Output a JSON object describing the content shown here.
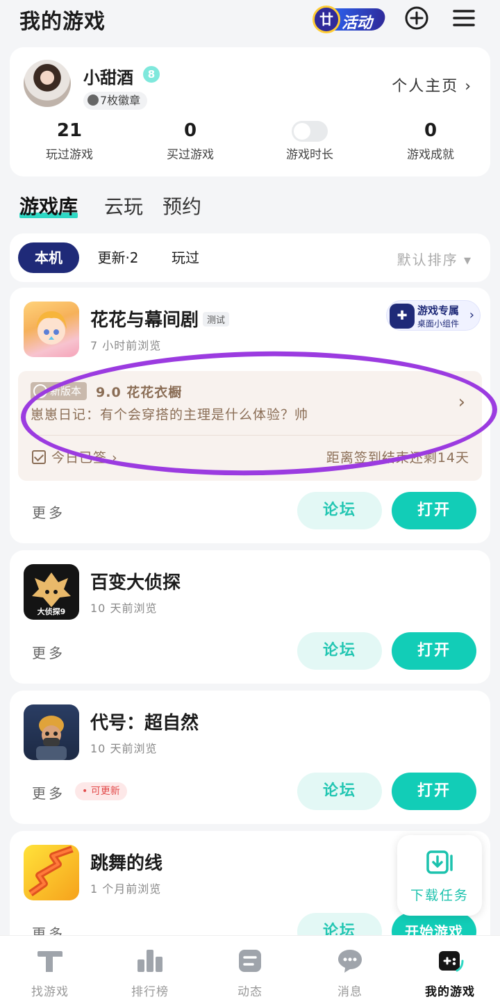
{
  "header": {
    "title": "我的游戏",
    "activity_label": "活动",
    "activity_icon_char": "廿"
  },
  "profile": {
    "username": "小甜酒",
    "level": "8",
    "medals": "7枚徽章",
    "home_link": "个人主页 ›",
    "stats": [
      {
        "value": "21",
        "label": "玩过游戏"
      },
      {
        "value": "0",
        "label": "买过游戏"
      },
      {
        "value": "",
        "label": "游戏时长"
      },
      {
        "value": "0",
        "label": "游戏成就"
      }
    ]
  },
  "library_tabs": [
    "游戏库",
    "云玩",
    "预约"
  ],
  "filters": {
    "chips": [
      "本机",
      "更新·2",
      "玩过"
    ],
    "sort": "默认排序 ▾"
  },
  "games": [
    {
      "name": "花花与幕间剧",
      "tag": "测试",
      "sub": "7 小时前浏览",
      "widget": {
        "title": "游戏专属",
        "subtitle": "桌面小组件"
      },
      "news": {
        "tag": "新版本",
        "title": "9.0 花花衣橱",
        "desc": "崽崽日记：有个会穿搭的主理是什么体验？帅",
        "signin": "今日已签 ›",
        "remain": "距离签到结束还剩14天"
      },
      "more": "更多",
      "forum": "论坛",
      "open": "打开"
    },
    {
      "name": "百变大侦探",
      "sub": "10 天前浏览",
      "icon_text": "大侦探9",
      "more": "更多",
      "forum": "论坛",
      "open": "打开"
    },
    {
      "name": "代号：超自然",
      "sub": "10 天前浏览",
      "update_badge": "• 可更新",
      "more": "更多",
      "forum": "论坛",
      "open": "打开"
    },
    {
      "name": "跳舞的线",
      "sub": "1 个月前浏览",
      "more": "更多",
      "forum": "论坛",
      "open": "开始游戏"
    }
  ],
  "fab": {
    "label": "下载任务"
  },
  "bottom_nav": [
    {
      "label": "找游戏",
      "icon": "find-game-icon"
    },
    {
      "label": "排行榜",
      "icon": "ranking-icon"
    },
    {
      "label": "动态",
      "icon": "feed-icon"
    },
    {
      "label": "消息",
      "icon": "message-icon"
    },
    {
      "label": "我的游戏",
      "icon": "my-games-icon",
      "active": true
    }
  ],
  "colors": {
    "accent": "#12cdb7",
    "nav_chip": "#1f2a78",
    "annotation": "#9b3be0"
  }
}
